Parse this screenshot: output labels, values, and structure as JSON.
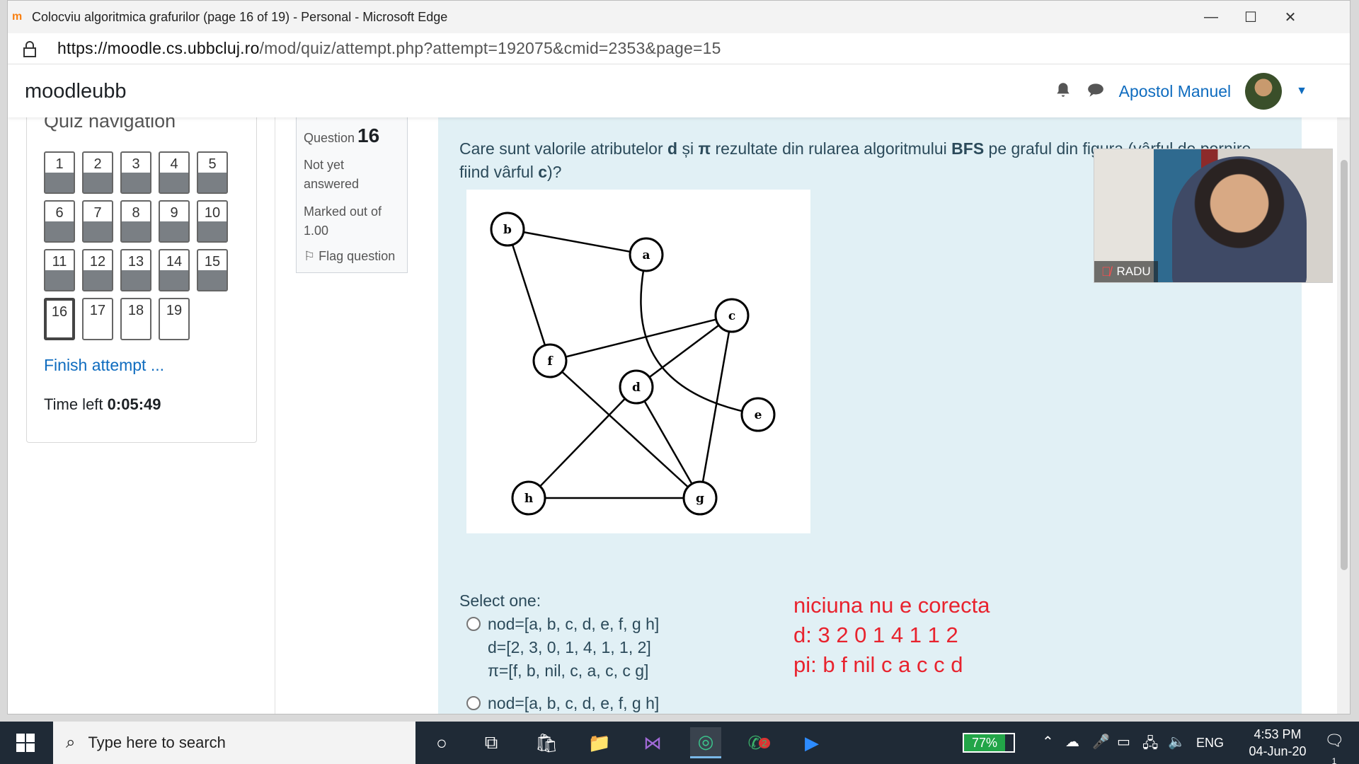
{
  "window": {
    "title": "Colocviu algoritmica grafurilor (page 16 of 19) - Personal - Microsoft Edge",
    "app_icon": "m",
    "minimize": "—",
    "maximize": "☐",
    "close": "✕"
  },
  "address": {
    "url_host": "https://moodle.cs.ubbcluj.ro",
    "url_path": "/mod/quiz/attempt.php?attempt=192075&cmid=2353&page=15"
  },
  "header": {
    "brand": "moodleubb",
    "user_name": "Apostol Manuel"
  },
  "quiz_nav": {
    "title": "Quiz navigation",
    "buttons": [
      {
        "label": "1",
        "state": "answered"
      },
      {
        "label": "2",
        "state": "answered"
      },
      {
        "label": "3",
        "state": "answered"
      },
      {
        "label": "4",
        "state": "answered"
      },
      {
        "label": "5",
        "state": "answered"
      },
      {
        "label": "6",
        "state": "answered"
      },
      {
        "label": "7",
        "state": "answered"
      },
      {
        "label": "8",
        "state": "answered"
      },
      {
        "label": "9",
        "state": "answered"
      },
      {
        "label": "10",
        "state": "answered"
      },
      {
        "label": "11",
        "state": "answered"
      },
      {
        "label": "12",
        "state": "answered"
      },
      {
        "label": "13",
        "state": "answered"
      },
      {
        "label": "14",
        "state": "answered"
      },
      {
        "label": "15",
        "state": "answered"
      },
      {
        "label": "16",
        "state": "current"
      },
      {
        "label": "17",
        "state": "unanswered"
      },
      {
        "label": "18",
        "state": "unanswered"
      },
      {
        "label": "19",
        "state": "unanswered"
      }
    ],
    "finish": "Finish attempt ...",
    "time_label": "Time left",
    "time_value": "0:05:49"
  },
  "question_info": {
    "label": "Question",
    "number": "16",
    "status": "Not yet answered",
    "marked": "Marked out of 1.00",
    "flag": "Flag question"
  },
  "question": {
    "text_html_parts": [
      "Care sunt valorile atributelor ",
      "d",
      " și ",
      "π",
      " rezultate din rularea algoritmului ",
      "BFS",
      " pe graful din figura (vârful de pornire fiind vârful ",
      "c",
      ")?"
    ],
    "graph_nodes": [
      "b",
      "a",
      "c",
      "f",
      "d",
      "e",
      "h",
      "g"
    ],
    "select_one": "Select one:",
    "options": [
      {
        "lines": [
          "nod=[a, b, c, d, e, f, g h]",
          "d=[2, 3, 0, 1, 4, 1, 1, 2]",
          "π=[f, b, nil, c, a, c, c g]"
        ]
      },
      {
        "lines": [
          "nod=[a, b, c, d, e, f, g h]"
        ]
      }
    ]
  },
  "annotations": [
    "niciuna nu e corecta",
    "d: 3 2 0 1 4 1 1 2",
    "pi: b f nil c a c c d"
  ],
  "video": {
    "participant": "RADU"
  },
  "taskbar": {
    "search_placeholder": "Type here to search",
    "battery": "77%",
    "language": "ENG",
    "time": "4:53 PM",
    "date": "04-Jun-20",
    "badge_count": "2",
    "notification_count": "1"
  }
}
